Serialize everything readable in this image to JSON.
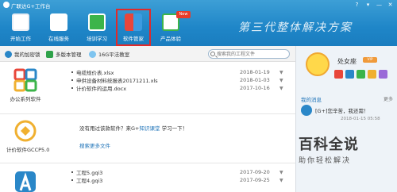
{
  "window": {
    "title": "广联达G+工作台",
    "controls": [
      "?",
      "▾",
      "—",
      "✕"
    ]
  },
  "toolbar": {
    "items": [
      {
        "label": "开始工作"
      },
      {
        "label": "在线服务"
      },
      {
        "label": "培训学习"
      },
      {
        "label": "软件管家"
      },
      {
        "label": "产品体验"
      }
    ],
    "new_badge": "New",
    "slogan": "第三代整体解决方案"
  },
  "subbar": {
    "items": [
      {
        "label": "我的加密锁"
      },
      {
        "label": "多版本管理"
      },
      {
        "label": "16G平法教室"
      }
    ],
    "search_placeholder": "搜索我的工程文件"
  },
  "sections": [
    {
      "icon_label": "办公系列软件",
      "files": [
        {
          "name": "电缆规价表.xlsx",
          "date": "2018-01-19"
        },
        {
          "name": "申供设备材料统报表20171211.xls",
          "date": "2018-01-03"
        },
        {
          "name": "计价软件的运用.docx",
          "date": "2017-10-16"
        }
      ]
    },
    {
      "icon_label": "计价软件GCCP5.0",
      "empty_text": "没有用过该款软件？来G+",
      "empty_link": "知识课堂",
      "empty_suffix": "学习一下！",
      "more_link": "搜索更多文件"
    },
    {
      "icon_label": "",
      "files": [
        {
          "name": "工程5.gqi3",
          "date": "2017-09-20"
        },
        {
          "name": "工程4.gqi3",
          "date": "2017-09-25"
        }
      ]
    }
  ],
  "user": {
    "name": "处女座",
    "vip_label": "VIP"
  },
  "messages": {
    "title": "我的消息",
    "more": "更多",
    "items": [
      {
        "text": "[G+]您辛苦，我还需！",
        "time": "2018-01-15 05:58"
      }
    ]
  },
  "watermark": {
    "main": "百科全说",
    "sub": "助你轻松解决"
  }
}
